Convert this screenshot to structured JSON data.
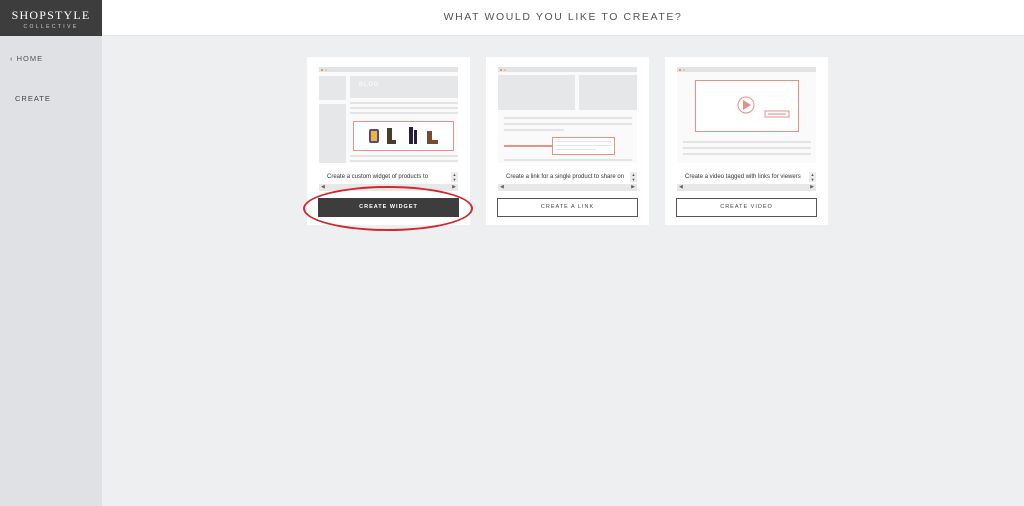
{
  "logo": {
    "brand": "SHOPSTYLE",
    "sub": "COLLECTIVE"
  },
  "sidebar": {
    "home_label": "‹ HOME",
    "create_label": "CREATE"
  },
  "header": {
    "title": "WHAT WOULD YOU LIKE TO CREATE?"
  },
  "preview_texts": {
    "blog": "BLOG"
  },
  "cards": [
    {
      "description": "Create a custom widget of products to",
      "button_label": "CREATE WIDGET"
    },
    {
      "description": "Create a link for a single product to share on",
      "button_label": "CREATE A LINK"
    },
    {
      "description": "Create a video tagged with links for viewers",
      "button_label": "CREATE VIDEO"
    }
  ],
  "colors": {
    "accent": "#e88f86",
    "dark": "#3d3d3d",
    "annotation": "#d0282e"
  }
}
